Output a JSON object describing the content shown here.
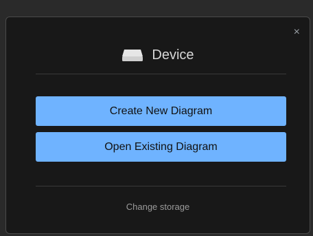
{
  "dialog": {
    "close_symbol": "×",
    "header": {
      "icon": "hard-drive-icon",
      "title": "Device"
    },
    "buttons": {
      "create": "Create New Diagram",
      "open": "Open Existing Diagram"
    },
    "footer_link": "Change storage"
  },
  "colors": {
    "button_bg": "#6fb3ff",
    "dialog_bg": "#181818",
    "text_light": "#d7d7d7"
  }
}
